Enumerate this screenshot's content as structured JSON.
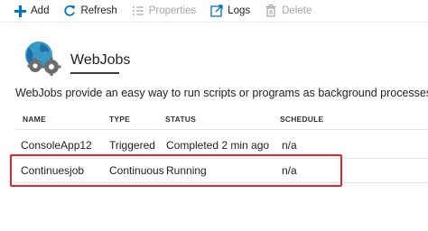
{
  "toolbar": {
    "add_label": "Add",
    "refresh_label": "Refresh",
    "properties_label": "Properties",
    "logs_label": "Logs",
    "delete_label": "Delete"
  },
  "section": {
    "title": "WebJobs",
    "description": "WebJobs provide an easy way to run scripts or programs as background processes in the conte"
  },
  "table": {
    "headers": [
      "NAME",
      "TYPE",
      "STATUS",
      "SCHEDULE"
    ],
    "rows": [
      [
        "ConsoleApp12",
        "Triggered",
        "Completed 2 min ago",
        "n/a"
      ],
      [
        "Continuesjob",
        "Continuous",
        "Running",
        "n/a"
      ]
    ]
  },
  "colors": {
    "accent": "#0072c6",
    "highlight_border": "#e2262d",
    "disabled_text": "#a6a6a6"
  }
}
